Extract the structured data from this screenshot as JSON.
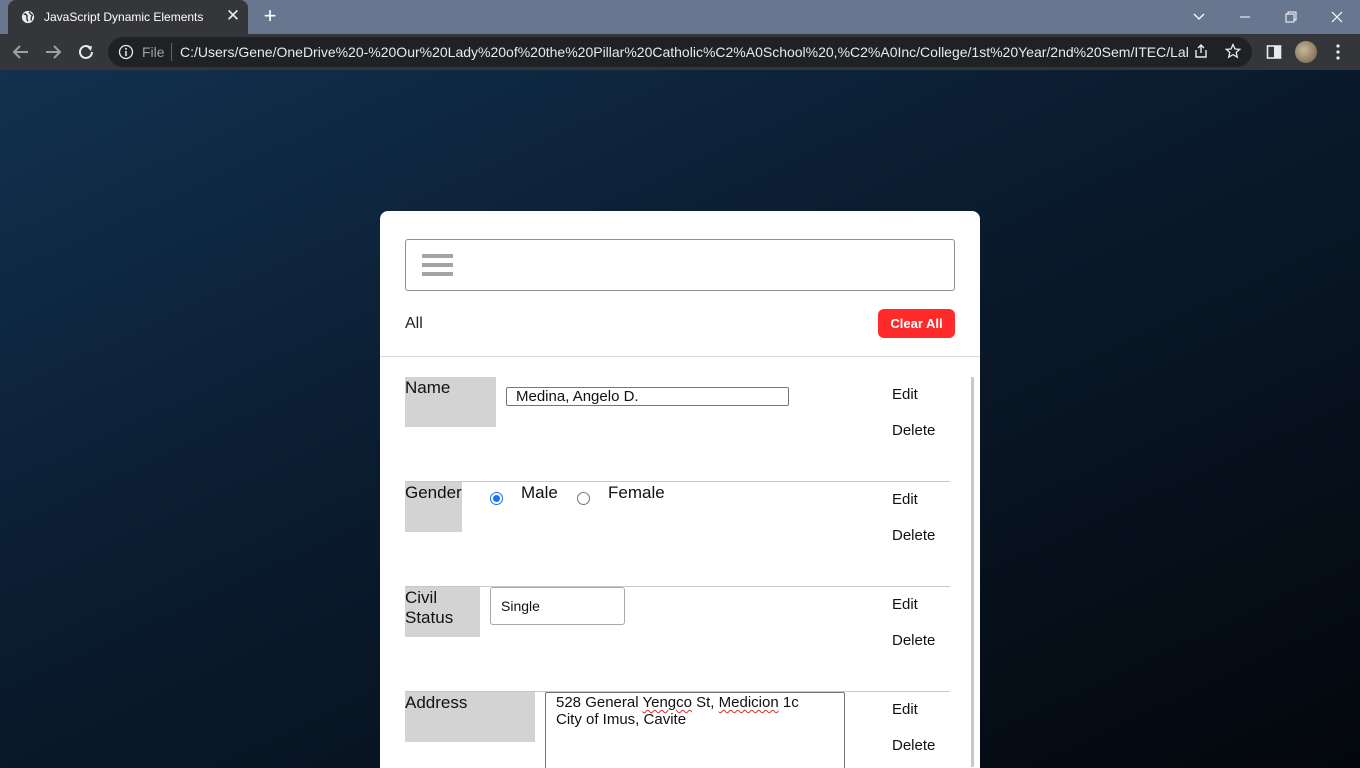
{
  "browser": {
    "tab_title": "JavaScript Dynamic Elements",
    "tab_close": "✕",
    "new_tab": "+",
    "file_label": "File",
    "url": "C:/Users/Gene/OneDrive%20-%20Our%20Lady%20of%20the%20Pillar%20Catholic%C2%A0School%20,%C2%A0Inc/College/1st%20Year/2nd%20Sem/ITEC/Lab%..."
  },
  "app": {
    "filter_label": "All",
    "clear_all_label": "Clear All",
    "fields": {
      "name": {
        "label": "Name",
        "value": "Medina, Angelo D."
      },
      "gender": {
        "label": "Gender",
        "options": [
          "Male",
          "Female"
        ],
        "selected": "Male"
      },
      "civil_status": {
        "label_line1": "Civil",
        "label_line2": "Status",
        "value": "Single"
      },
      "address": {
        "label": "Address",
        "line1_prefix": "528 General ",
        "line1_word1": "Yengco",
        "line1_mid": " St, ",
        "line1_word2": "Medicion",
        "line1_suffix": " 1c",
        "line2": "City of Imus, Cavite"
      }
    },
    "actions": {
      "edit": "Edit",
      "delete": "Delete"
    }
  },
  "colors": {
    "clear_button": "#ff2a2a",
    "radio_accent": "#1a73e8",
    "label_background": "#d3d3d3"
  }
}
